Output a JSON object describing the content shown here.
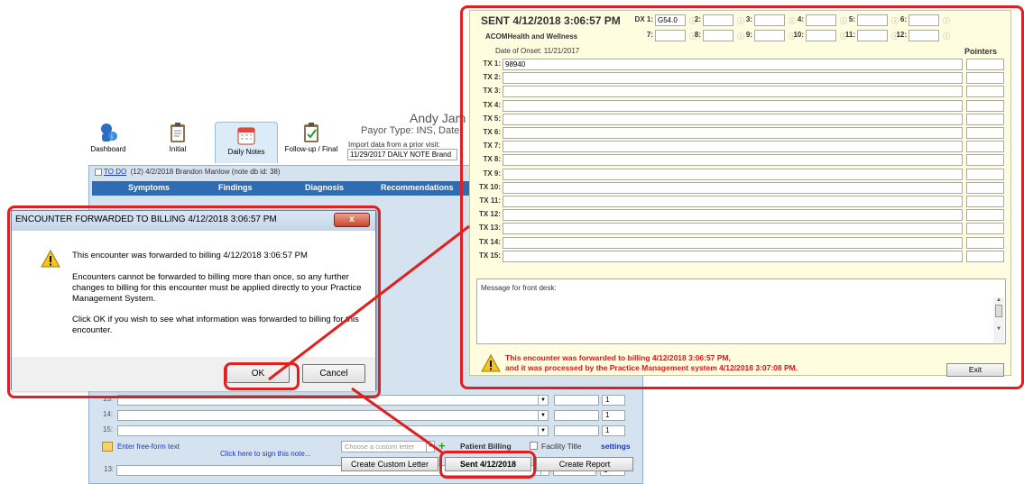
{
  "patient": {
    "name": "Andy Jam",
    "payor": "Payor Type: INS, Date",
    "import_label": "Import data from a prior visit:",
    "import_value": "11/29/2017 DAILY NOTE Brand"
  },
  "nav": [
    {
      "label": "Dashboard",
      "icon": "dashboard-icon"
    },
    {
      "label": "Initial",
      "icon": "clipboard-icon"
    },
    {
      "label": "Daily Notes",
      "icon": "calendar-icon"
    },
    {
      "label": "Follow-up / Final",
      "icon": "clipboard-check-icon"
    }
  ],
  "todo": {
    "link": "TO DO",
    "text": "(12) 4/2/2018 Brandon Manlow (note db id: 38)"
  },
  "tabs": [
    "Symptoms",
    "Findings",
    "Diagnosis",
    "Recommendations"
  ],
  "rows": [
    {
      "num": "13:",
      "count": "1"
    },
    {
      "num": "14:",
      "count": "1"
    },
    {
      "num": "15:",
      "count": "1"
    }
  ],
  "footer": {
    "free_form": "Enter free-form text",
    "sign": "Click here to sign this note...",
    "custom_letter_placeholder": "Choose a custom letter",
    "patient_billing": "Patient Billing",
    "facility_title": "Facility Title",
    "settings": "settings",
    "create_custom_letter": "Create Custom Letter",
    "sent": "Sent 4/12/2018",
    "create_report": "Create Report"
  },
  "dialog": {
    "title": "ENCOUNTER FORWARDED TO BILLING 4/12/2018 3:06:57 PM",
    "close": "x",
    "line1": "This encounter was forwarded to billing 4/12/2018 3:06:57 PM",
    "line2": "Encounters cannot be forwarded to billing more than once, so any further changes to billing for this encounter must be applied directly to your Practice Management System.",
    "line3": "Click OK if you wish to see what information was forwarded to billing for this encounter.",
    "ok": "OK",
    "cancel": "Cancel"
  },
  "billing": {
    "header": "SENT 4/12/2018 3:06:57 PM",
    "org": "ACOMHealth and Wellness",
    "onset": "Date of Onset: 11/21/2017",
    "dx": [
      {
        "label": "DX 1:",
        "value": "G54.0"
      },
      {
        "label": "2:",
        "value": ""
      },
      {
        "label": "3:",
        "value": ""
      },
      {
        "label": "4:",
        "value": ""
      },
      {
        "label": "5:",
        "value": ""
      },
      {
        "label": "6:",
        "value": ""
      },
      {
        "label": "7:",
        "value": ""
      },
      {
        "label": "8:",
        "value": ""
      },
      {
        "label": "9:",
        "value": ""
      },
      {
        "label": "10:",
        "value": ""
      },
      {
        "label": "11:",
        "value": ""
      },
      {
        "label": "12:",
        "value": ""
      }
    ],
    "info_glyph": "ⓘ",
    "pointers_label": "Pointers",
    "tx": [
      {
        "label": "TX 1:",
        "value": "98940"
      },
      {
        "label": "TX 2:",
        "value": ""
      },
      {
        "label": "TX 3:",
        "value": ""
      },
      {
        "label": "TX 4:",
        "value": ""
      },
      {
        "label": "TX 5:",
        "value": ""
      },
      {
        "label": "TX 6:",
        "value": ""
      },
      {
        "label": "TX 7:",
        "value": ""
      },
      {
        "label": "TX 8:",
        "value": ""
      },
      {
        "label": "TX 9:",
        "value": ""
      },
      {
        "label": "TX 10:",
        "value": ""
      },
      {
        "label": "TX 11:",
        "value": ""
      },
      {
        "label": "TX 12:",
        "value": ""
      },
      {
        "label": "TX 13:",
        "value": ""
      },
      {
        "label": "TX 14:",
        "value": ""
      },
      {
        "label": "TX 15:",
        "value": ""
      }
    ],
    "message_label": "Message for front desk:",
    "warning_line1": "This encounter was forwarded to billing 4/12/2018 3:06:57 PM,",
    "warning_line2": "and it was processed by the Practice Management system 4/12/2018 3:07:08 PM.",
    "exit": "Exit"
  },
  "colors": {
    "highlight": "#e02020",
    "warning_text": "#e3131a",
    "tab_bar": "#2e6db4",
    "panel_bg": "#fffde0"
  }
}
